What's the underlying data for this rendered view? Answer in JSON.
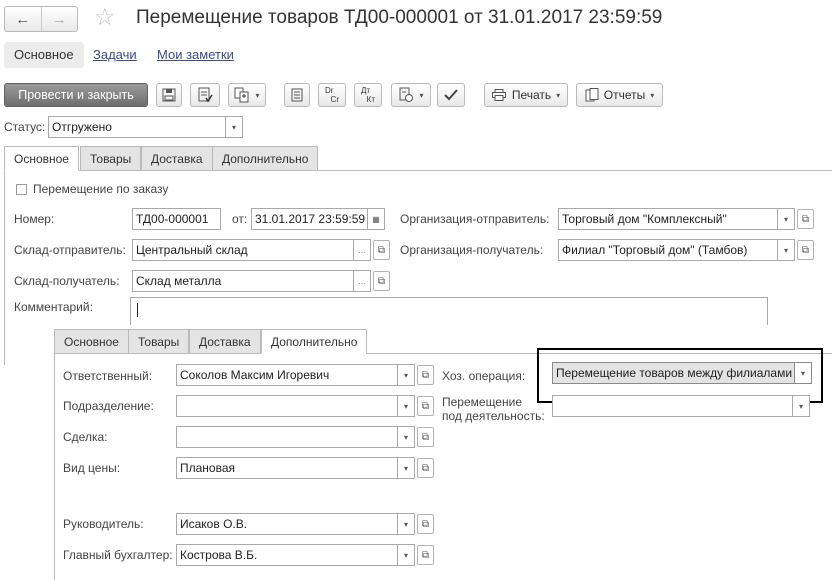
{
  "window": {
    "title": "Перемещение товаров ТД00-000001 от 31.01.2017 23:59:59"
  },
  "nav": {
    "back_icon": "←",
    "forward_icon": "→",
    "star_icon": "☆"
  },
  "section_tabs": {
    "main": "Основное",
    "tasks": "Задачи",
    "notes": "Мои заметки"
  },
  "toolbar": {
    "post_close": "Провести и закрыть",
    "dr_cr": [
      "Dr",
      "Cr"
    ],
    "dt_kt": [
      "Дт",
      "Кт"
    ],
    "print": "Печать",
    "reports": "Отчеты"
  },
  "status": {
    "label": "Статус:",
    "value": "Отгружено"
  },
  "tabs": [
    "Основное",
    "Товары",
    "Доставка",
    "Дополнительно"
  ],
  "form": {
    "by_order": "Перемещение по заказу",
    "number_label": "Номер:",
    "number_value": "ТД00-000001",
    "date_label": "от:",
    "date_value": "31.01.2017 23:59:59",
    "org_sender_label": "Организация-отправитель:",
    "org_sender_value": "Торговый дом \"Комплексный\"",
    "wh_sender_label": "Склад-отправитель:",
    "wh_sender_value": "Центральный склад",
    "org_receiver_label": "Организация-получатель:",
    "org_receiver_value": "Филиал \"Торговый дом\" (Тамбов)",
    "wh_receiver_label": "Склад-получатель:",
    "wh_receiver_value": "Склад металла",
    "comment_label": "Комментарий:",
    "comment_value": ""
  },
  "inner_tabs": [
    "Основное",
    "Товары",
    "Доставка",
    "Дополнительно"
  ],
  "extra": {
    "responsible_label": "Ответственный:",
    "responsible_value": "Соколов Максим Игоревич",
    "department_label": "Подразделение:",
    "department_value": "",
    "deal_label": "Сделка:",
    "deal_value": "",
    "price_type_label": "Вид цены:",
    "price_type_value": "Плановая",
    "manager_label": "Руководитель:",
    "manager_value": "Исаков О.В.",
    "accountant_label": "Главный бухгалтер:",
    "accountant_value": "Кострова В.Б.",
    "operation_label": "Хоз. операция:",
    "operation_value": "Перемещение товаров между филиалами",
    "activity_label_1": "Перемещение",
    "activity_label_2": "под деятельность:",
    "activity_value": ""
  },
  "icons": {
    "dropdown": "▾",
    "open": "⧉",
    "choose": "...",
    "calendar": "▦"
  }
}
